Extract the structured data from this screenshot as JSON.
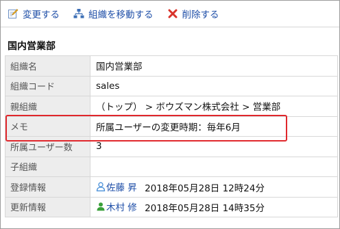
{
  "toolbar": {
    "edit_label": "変更する",
    "move_label": "組織を移動する",
    "delete_label": "削除する"
  },
  "section": {
    "title": "国内営業部"
  },
  "rows": {
    "org_name": {
      "label": "組織名",
      "value": "国内営業部"
    },
    "org_code": {
      "label": "組織コード",
      "value": "sales"
    },
    "parent": {
      "label": "親組織",
      "value": "（トップ） > ボウズマン株式会社 > 営業部"
    },
    "memo": {
      "label": "メモ",
      "value": "所属ユーザーの変更時期：毎年6月"
    },
    "member_count": {
      "label": "所属ユーザー数",
      "value": "3"
    },
    "children": {
      "label": "子組織",
      "value": ""
    },
    "registered": {
      "label": "登録情報",
      "user": "佐藤 昇",
      "timestamp": "2018年05月28日 12時24分"
    },
    "updated": {
      "label": "更新情報",
      "user": "木村 修",
      "timestamp": "2018年05月28日 14時35分"
    }
  },
  "colors": {
    "link": "#1f4fa8",
    "highlight": "#e0262b",
    "label_bg": "#ededed",
    "delete_icon": "#d9332b",
    "registered_user_icon": "#4a90d9",
    "updated_user_icon": "#3aa03a"
  },
  "icons": {
    "edit": "pencil-note-icon",
    "move": "org-tree-icon",
    "delete": "x-mark-icon",
    "user": "user-icon"
  }
}
